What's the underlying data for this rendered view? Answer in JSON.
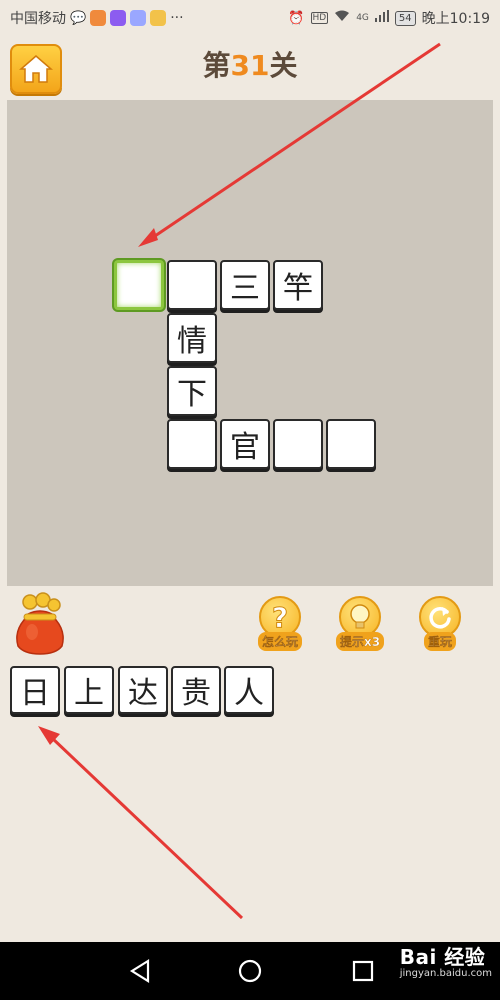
{
  "status_bar": {
    "carrier": "中国移动",
    "battery": "54",
    "network": "4G",
    "time": "晚上10:19",
    "dots": "···"
  },
  "header": {
    "title_prefix": "第",
    "level_number": "31",
    "title_suffix": "关"
  },
  "board": {
    "cells": [
      {
        "char": "",
        "selected": true
      },
      {
        "char": ""
      },
      {
        "char": "三"
      },
      {
        "char": "竿"
      },
      {
        "char": "情"
      },
      {
        "char": "下"
      },
      {
        "char": ""
      },
      {
        "char": "官"
      },
      {
        "char": ""
      },
      {
        "char": ""
      }
    ]
  },
  "controls": {
    "how_to_play": "怎么玩",
    "hint": "提示x3",
    "replay": "重玩"
  },
  "candidates": [
    "日",
    "上",
    "达",
    "贵",
    "人"
  ],
  "watermark": {
    "main": "Bai 经验",
    "sub": "jingyan.baidu.com"
  },
  "colors": {
    "background": "#efe9e0",
    "board": "#ccc6bc",
    "selected_border": "#8cc63f",
    "accent_orange": "#f3a51a",
    "arrow": "#e53935"
  }
}
